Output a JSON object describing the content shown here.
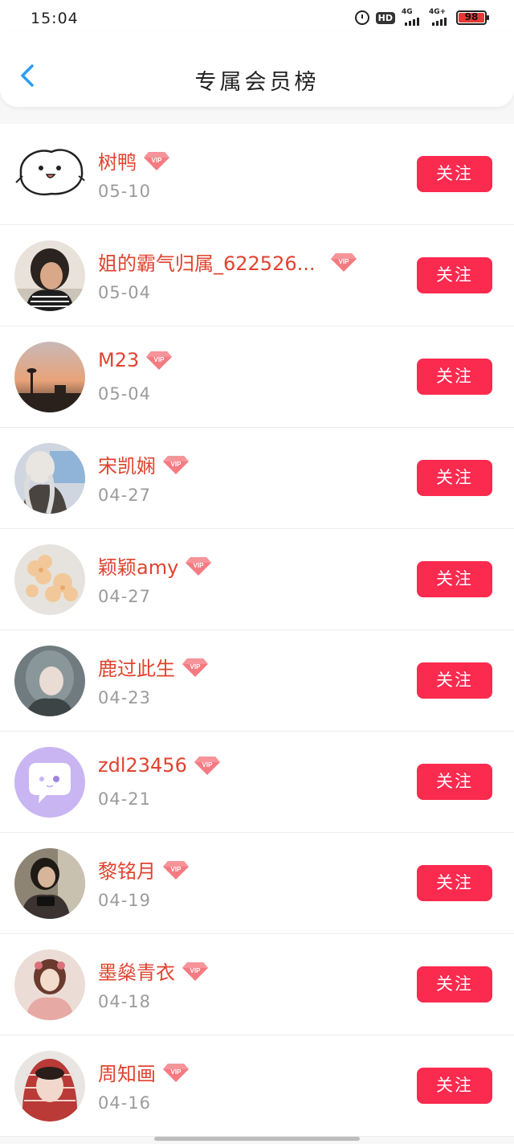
{
  "status_bar": {
    "time": "15:04",
    "hd": "HD",
    "net1": "4G",
    "net2": "4G+",
    "battery": "98"
  },
  "header": {
    "title": "专属会员榜"
  },
  "vip_badge_text": "VIP",
  "colors": {
    "accent": "#fb2a4f",
    "name": "#e0432f",
    "date": "#9b9b9b",
    "back": "#2a9df4"
  },
  "members": [
    {
      "name": "树鸭",
      "date": "05-10",
      "follow_label": "关注",
      "avatar_icon": "cartoon-face-avatar"
    },
    {
      "name": "姐的霸气归属_622526...",
      "date": "05-04",
      "follow_label": "关注",
      "avatar_icon": "woman-photo-avatar"
    },
    {
      "name": "M23",
      "date": "05-04",
      "follow_label": "关注",
      "avatar_icon": "sunset-tower-avatar"
    },
    {
      "name": "宋凯娴",
      "date": "04-27",
      "follow_label": "关注",
      "avatar_icon": "girl-photo-avatar"
    },
    {
      "name": "颖颖amy",
      "date": "04-27",
      "follow_label": "关注",
      "avatar_icon": "flower-avatar"
    },
    {
      "name": "鹿过此生",
      "date": "04-23",
      "follow_label": "关注",
      "avatar_icon": "grey-hair-girl-avatar"
    },
    {
      "name": "zdl23456",
      "date": "04-21",
      "follow_label": "关注",
      "avatar_icon": "chat-bubble-default-avatar"
    },
    {
      "name": "黎铭月",
      "date": "04-19",
      "follow_label": "关注",
      "avatar_icon": "girl-camera-avatar"
    },
    {
      "name": "墨燊青衣",
      "date": "04-18",
      "follow_label": "关注",
      "avatar_icon": "illustrated-girl-avatar"
    },
    {
      "name": "周知画",
      "date": "04-16",
      "follow_label": "关注",
      "avatar_icon": "red-hood-girl-avatar"
    }
  ]
}
